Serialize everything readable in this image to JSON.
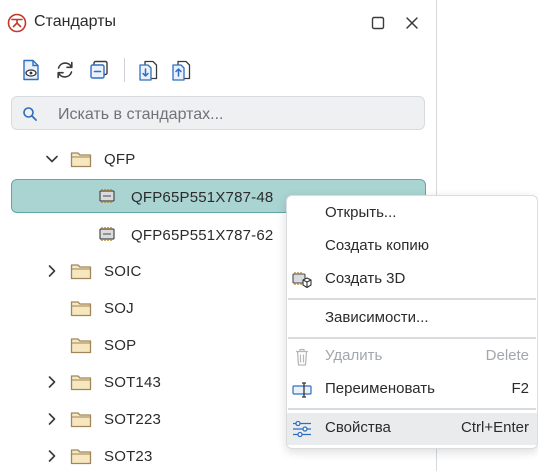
{
  "window": {
    "title": "Стандарты",
    "icons": {
      "app": "app-logo-icon",
      "maximize": "maximize-icon",
      "close": "close-icon"
    }
  },
  "toolbar": {
    "buttons": [
      "preview-document-icon",
      "refresh-icon",
      "collapse-icon",
      "import-icon",
      "export-icon"
    ]
  },
  "search": {
    "placeholder": "Искать в стандартах...",
    "value": ""
  },
  "tree": {
    "items": [
      {
        "label": "QFP",
        "type": "folder",
        "expanded": true
      },
      {
        "label": "QFP65P551X787-48",
        "type": "component",
        "selected": true
      },
      {
        "label": "QFP65P551X787-62",
        "type": "component"
      },
      {
        "label": "SOIC",
        "type": "folder",
        "expanded": false
      },
      {
        "label": "SOJ",
        "type": "folder"
      },
      {
        "label": "SOP",
        "type": "folder"
      },
      {
        "label": "SOT143",
        "type": "folder",
        "expanded": false
      },
      {
        "label": "SOT223",
        "type": "folder",
        "expanded": false
      },
      {
        "label": "SOT23",
        "type": "folder",
        "expanded": false
      }
    ]
  },
  "context_menu": {
    "items": [
      {
        "label": "Открыть...",
        "shortcut": ""
      },
      {
        "label": "Создать копию",
        "shortcut": ""
      },
      {
        "label": "Создать 3D",
        "shortcut": "",
        "icon": "cube-chip-icon"
      },
      {
        "label": "Зависимости...",
        "shortcut": ""
      },
      {
        "label": "Удалить",
        "shortcut": "Delete",
        "disabled": true,
        "icon": "trash-icon"
      },
      {
        "label": "Переименовать",
        "shortcut": "F2",
        "icon": "rename-icon"
      },
      {
        "label": "Свойства",
        "shortcut": "Ctrl+Enter",
        "icon": "settings-sliders-icon"
      }
    ]
  },
  "colors": {
    "selection_bg": "#a9d4d2",
    "selection_border": "#5fa8a5",
    "accent": "#2f6fc0",
    "logo_red": "#c0392b",
    "folder_fill": "#f6e7bf",
    "folder_stroke": "#a0865a"
  }
}
